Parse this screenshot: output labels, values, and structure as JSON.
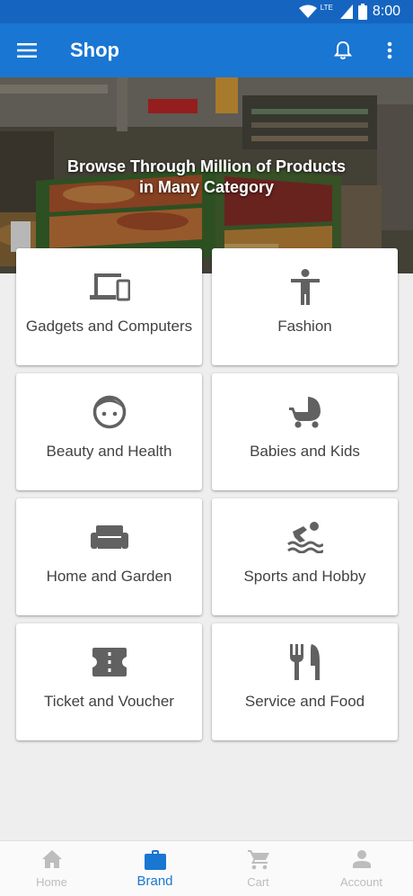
{
  "status_bar": {
    "time": "8:00",
    "network": "LTE"
  },
  "app_bar": {
    "title": "Shop",
    "menu_icon": "menu-icon",
    "bell_icon": "bell-icon",
    "more_icon": "more-vert-icon"
  },
  "hero": {
    "line1": "Browse Through Million of Products",
    "line2": "in Many Category"
  },
  "categories": [
    {
      "label": "Gadgets and Computers",
      "icon": "devices-icon"
    },
    {
      "label": "Fashion",
      "icon": "person-icon"
    },
    {
      "label": "Beauty and Health",
      "icon": "face-icon"
    },
    {
      "label": "Babies and Kids",
      "icon": "stroller-icon"
    },
    {
      "label": "Home and Garden",
      "icon": "sofa-icon"
    },
    {
      "label": "Sports and Hobby",
      "icon": "pool-icon"
    },
    {
      "label": "Ticket and Voucher",
      "icon": "ticket-icon"
    },
    {
      "label": "Service and Food",
      "icon": "restaurant-icon"
    }
  ],
  "bottom_nav": [
    {
      "label": "Home",
      "icon": "home-icon",
      "active": false
    },
    {
      "label": "Brand",
      "icon": "briefcase-icon",
      "active": true
    },
    {
      "label": "Cart",
      "icon": "cart-icon",
      "active": false
    },
    {
      "label": "Account",
      "icon": "person-icon",
      "active": false
    }
  ],
  "colors": {
    "primary": "#1976d2",
    "primary_dark": "#1565c0",
    "icon_gray": "#616161",
    "text_gray": "#424242",
    "inactive": "#bdbdbd"
  }
}
